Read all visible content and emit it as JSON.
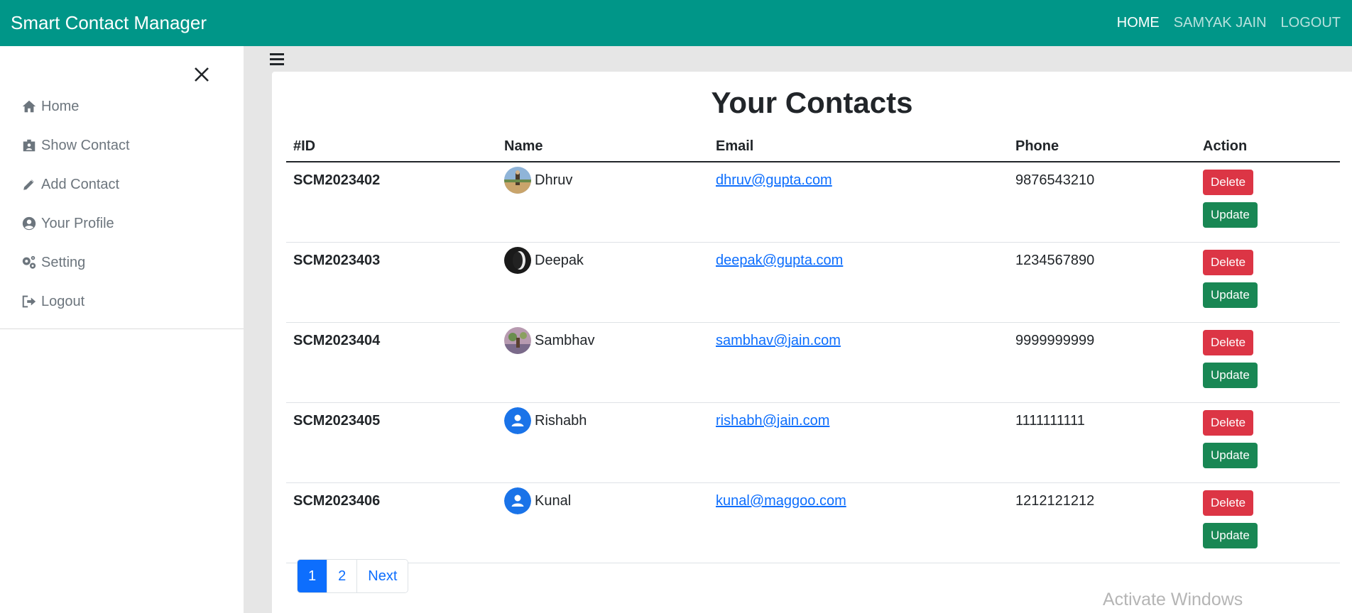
{
  "navbar": {
    "brand": "Smart Contact Manager",
    "links": [
      "HOME",
      "SAMYAK JAIN",
      "LOGOUT"
    ]
  },
  "sidebar": {
    "items": [
      {
        "label": "Home",
        "icon": "home-icon"
      },
      {
        "label": "Show Contact",
        "icon": "id-card-icon"
      },
      {
        "label": "Add Contact",
        "icon": "pencil-icon"
      },
      {
        "label": "Your Profile",
        "icon": "user-circle-icon"
      },
      {
        "label": "Setting",
        "icon": "gears-icon"
      },
      {
        "label": "Logout",
        "icon": "sign-out-icon"
      }
    ]
  },
  "main": {
    "title": "Your Contacts",
    "columns": [
      "#ID",
      "Name",
      "Email",
      "Phone",
      "Action"
    ],
    "rows": [
      {
        "id": "SCM2023402",
        "name": "Dhruv",
        "email": "dhruv@gupta.com",
        "phone": "9876543210",
        "avatar": "photo"
      },
      {
        "id": "SCM2023403",
        "name": "Deepak",
        "email": "deepak@gupta.com",
        "phone": "1234567890",
        "avatar": "photo"
      },
      {
        "id": "SCM2023404",
        "name": "Sambhav",
        "email": "sambhav@jain.com",
        "phone": "9999999999",
        "avatar": "photo"
      },
      {
        "id": "SCM2023405",
        "name": "Rishabh",
        "email": "rishabh@jain.com",
        "phone": "1111111111",
        "avatar": "default"
      },
      {
        "id": "SCM2023406",
        "name": "Kunal",
        "email": "kunal@maggoo.com",
        "phone": "1212121212",
        "avatar": "default"
      }
    ],
    "delete_label": "Delete",
    "update_label": "Update"
  },
  "pagination": {
    "pages": [
      "1",
      "2"
    ],
    "active": "1",
    "next": "Next"
  },
  "watermark": "Activate Windows",
  "colors": {
    "navbar": "#009688",
    "delete": "#dc3545",
    "update": "#198754",
    "link": "#0d6efd"
  }
}
